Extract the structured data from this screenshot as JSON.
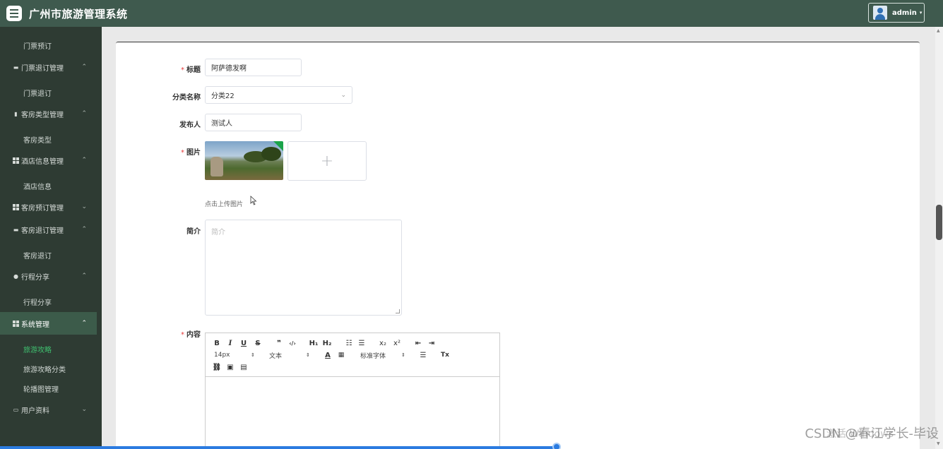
{
  "header": {
    "app_title": "广州市旅游管理系统",
    "user_name": "admin",
    "user_caret": "▾"
  },
  "sidebar": {
    "items": [
      {
        "label": "门票预订",
        "type": "sub"
      },
      {
        "label": "门票退订管理",
        "type": "group",
        "icon": "comment-icon",
        "chevron": "⌃"
      },
      {
        "label": "门票退订",
        "type": "sub"
      },
      {
        "label": "客房类型管理",
        "type": "group",
        "icon": "document-icon",
        "chevron": "⌃"
      },
      {
        "label": "客房类型",
        "type": "sub"
      },
      {
        "label": "酒店信息管理",
        "type": "group",
        "icon": "grid-icon",
        "chevron": "⌃"
      },
      {
        "label": "酒店信息",
        "type": "sub"
      },
      {
        "label": "客房预订管理",
        "type": "group",
        "icon": "grid-icon",
        "chevron": "⌄"
      },
      {
        "label": "客房退订管理",
        "type": "group",
        "icon": "storage-icon",
        "chevron": "⌃"
      },
      {
        "label": "客房退订",
        "type": "sub"
      },
      {
        "label": "行程分享",
        "type": "group",
        "icon": "user-icon",
        "chevron": "⌃"
      },
      {
        "label": "行程分享",
        "type": "sub"
      },
      {
        "label": "系统管理",
        "type": "group",
        "icon": "grid-icon",
        "chevron": "⌃"
      },
      {
        "label": "旅游攻略",
        "type": "sub"
      },
      {
        "label": "旅游攻略分类",
        "type": "sub"
      },
      {
        "label": "轮播图管理",
        "type": "sub"
      },
      {
        "label": "用户资料",
        "type": "group",
        "icon": "card-icon",
        "chevron": "⌄"
      }
    ]
  },
  "form": {
    "title_label": "标题",
    "title_value": "阿萨德发啊",
    "category_label": "分类名称",
    "category_value": "分类22",
    "publisher_label": "发布人",
    "publisher_value": "测试人",
    "image_label": "图片",
    "upload_plus": "+",
    "upload_hint": "点击上传图片",
    "intro_label": "简介",
    "intro_placeholder": "简介",
    "content_label": "内容",
    "required_mark": "*"
  },
  "editor": {
    "bold": "B",
    "italic": "I",
    "underline": "U",
    "strike": "S",
    "quote": "❞",
    "code": "‹/›",
    "h1": "H₁",
    "h2": "H₂",
    "ordered_list": "☷",
    "bullet_list": "☰",
    "subscript": "x₂",
    "superscript": "x²",
    "outdent": "⇤",
    "indent": "⇥",
    "font_size": "14px",
    "text_style": "文本",
    "font_family": "标准字体",
    "font_color": "A",
    "clear_format": "Tx",
    "updown": "⇕"
  },
  "watermark": "CSDN @春江学长-毕设",
  "watermark2": "激活 Windows"
}
